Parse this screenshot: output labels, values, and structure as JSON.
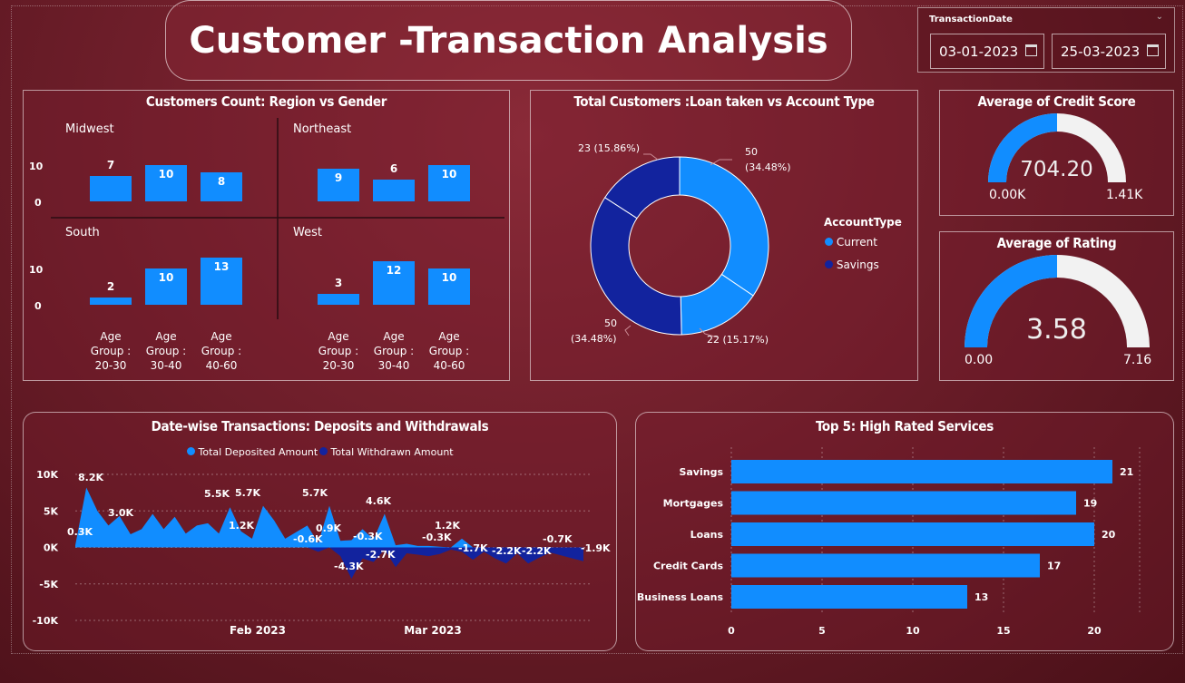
{
  "header": {
    "title": "Customer -Transaction Analysis"
  },
  "slicer": {
    "label": "TransactionDate",
    "start": "03-01-2023",
    "end": "25-03-2023"
  },
  "region_panel": {
    "title": "Customers Count: Region vs Gender",
    "regions": [
      {
        "name": "Midwest",
        "values": [
          7,
          10,
          8
        ]
      },
      {
        "name": "Northeast",
        "values": [
          9,
          6,
          10
        ]
      },
      {
        "name": "South",
        "values": [
          2,
          10,
          13
        ]
      },
      {
        "name": "West",
        "values": [
          3,
          12,
          10
        ]
      }
    ],
    "y_ticks": [
      "10",
      "0"
    ],
    "age_groups": [
      [
        "Age",
        "Group :",
        "20-30"
      ],
      [
        "Age",
        "Group :",
        "30-40"
      ],
      [
        "Age",
        "Group :",
        "40-60"
      ]
    ]
  },
  "donut_panel": {
    "title": "Total Customers :Loan taken vs Account Type",
    "legend_title": "AccountType",
    "legend": [
      {
        "name": "Current",
        "color": "#118dff"
      },
      {
        "name": "Savings",
        "color": "#12239e"
      }
    ],
    "segments": [
      {
        "account": "Current",
        "value": 50,
        "pct": "34.48%"
      },
      {
        "account": "Current",
        "value": 22,
        "pct": "15.17%"
      },
      {
        "account": "Savings",
        "value": 50,
        "pct": "34.48%"
      },
      {
        "account": "Savings",
        "value": 23,
        "pct": "15.86%"
      }
    ],
    "labels": {
      "a1": "50",
      "a2": "(34.48%)",
      "b": "22 (15.17%)",
      "c1": "50",
      "c2": "(34.48%)",
      "d": "23 (15.86%)"
    }
  },
  "credit_gauge": {
    "title": "Average of Credit Score",
    "value": 704.2,
    "value_label": "704.20",
    "min_label": "0.00K",
    "max_label": "1.41K",
    "fraction": 0.5
  },
  "rating_gauge": {
    "title": "Average of Rating",
    "value": 3.58,
    "value_label": "3.58",
    "min_label": "0.00",
    "max_label": "7.16",
    "fraction": 0.5
  },
  "area_panel": {
    "title": "Date-wise Transactions: Deposits and Withdrawals",
    "legend": [
      {
        "name": "Total Deposited Amount",
        "color": "#118dff"
      },
      {
        "name": "Total Withdrawn Amount",
        "color": "#12239e"
      }
    ],
    "y_ticks": [
      "10K",
      "5K",
      "0K",
      "-5K",
      "-10K"
    ],
    "x_ticks": [
      "Feb 2023",
      "Mar 2023"
    ],
    "data_labels": [
      "0.3K",
      "8.2K",
      "3.0K",
      "5.5K",
      "5.7K",
      "1.2K",
      "5.7K",
      "0.9K",
      "-0.6K",
      "4.6K",
      "-0.3K",
      "-4.3K",
      "-2.7K",
      "1.2K",
      "-0.3K",
      "-1.7K",
      "-2.2K",
      "-2.2K",
      "-0.7K",
      "-1.9K"
    ]
  },
  "chart_data": [
    {
      "type": "bar",
      "title": "Customers Count: Region vs Gender",
      "facets": [
        "Midwest",
        "Northeast",
        "South",
        "West"
      ],
      "categories": [
        "Age Group : 20-30",
        "Age Group : 30-40",
        "Age Group : 40-60"
      ],
      "series": [
        {
          "name": "Midwest",
          "values": [
            7,
            10,
            8
          ]
        },
        {
          "name": "Northeast",
          "values": [
            9,
            6,
            10
          ]
        },
        {
          "name": "South",
          "values": [
            2,
            10,
            13
          ]
        },
        {
          "name": "West",
          "values": [
            3,
            12,
            10
          ]
        }
      ],
      "ylim": [
        0,
        13
      ]
    },
    {
      "type": "pie",
      "title": "Total Customers :Loan taken vs Account Type",
      "values": [
        50,
        22,
        50,
        23
      ],
      "labels": [
        "Current",
        "Current",
        "Savings",
        "Savings"
      ]
    },
    {
      "type": "area",
      "title": "Date-wise Transactions: Deposits and Withdrawals",
      "ylim": [
        -10000,
        10000
      ],
      "series": [
        {
          "name": "Total Deposited Amount",
          "values": [
            300,
            8200,
            5000,
            3000,
            4300,
            1800,
            2500,
            4600,
            2500,
            4200,
            1900,
            3000,
            3300,
            1900,
            5500,
            2200,
            1200,
            5700,
            3700,
            1200,
            2100,
            3000,
            600,
            5700,
            900,
            1000,
            2500,
            1100,
            4600,
            300,
            500,
            200,
            200,
            100,
            0,
            1200,
            0,
            0,
            0,
            0,
            0,
            0,
            0,
            0,
            0,
            0,
            0
          ]
        },
        {
          "name": "Total Withdrawn Amount",
          "values": [
            0,
            0,
            0,
            0,
            0,
            0,
            0,
            0,
            0,
            0,
            0,
            0,
            0,
            0,
            0,
            0,
            0,
            0,
            0,
            0,
            0,
            0,
            -600,
            0,
            -1200,
            -4300,
            -1500,
            -2000,
            -300,
            -2700,
            -800,
            -1000,
            -1200,
            -900,
            -300,
            -600,
            -1700,
            -600,
            -1500,
            -2200,
            -800,
            -2200,
            -1400,
            -700,
            -1100,
            -1500,
            -1900
          ]
        }
      ]
    },
    {
      "type": "bar",
      "title": "Top 5: High Rated Services",
      "categories": [
        "Savings",
        "Mortgages",
        "Loans",
        "Credit Cards",
        "Business Loans"
      ],
      "values": [
        21,
        19,
        20,
        17,
        13
      ],
      "x_ticks": [
        "0",
        "5",
        "10",
        "15",
        "20"
      ],
      "xlim": [
        0,
        22.5
      ]
    }
  ],
  "services_panel": {
    "title": "Top 5: High Rated Services"
  }
}
